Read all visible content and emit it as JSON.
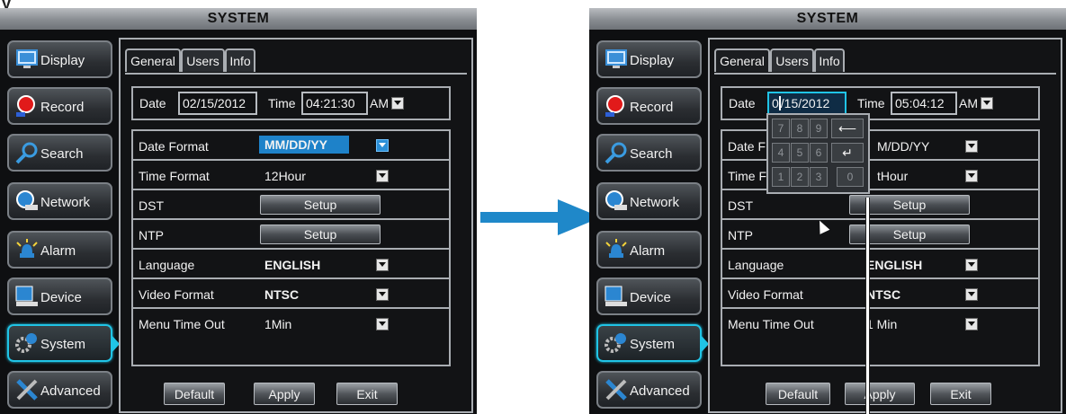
{
  "partial_heading": "y",
  "colors": {
    "accent": "#20c4e6",
    "arrow": "#1f88c9",
    "panel_bg": "#0e0f11",
    "highlight": "#1e82c9"
  },
  "left_panel": {
    "title": "SYSTEM",
    "sidebar": [
      {
        "label": "Display",
        "icon": "monitor-icon"
      },
      {
        "label": "Record",
        "icon": "record-icon"
      },
      {
        "label": "Search",
        "icon": "magnifier-icon"
      },
      {
        "label": "Network",
        "icon": "network-icon"
      },
      {
        "label": "Alarm",
        "icon": "alarm-icon"
      },
      {
        "label": "Device",
        "icon": "device-icon"
      },
      {
        "label": "System",
        "icon": "system-gear-icon",
        "active": true
      },
      {
        "label": "Advanced",
        "icon": "tools-icon"
      }
    ],
    "tabs": [
      "General",
      "Users",
      "Info"
    ],
    "date_label": "Date",
    "date_value": "02/15/2012",
    "time_label": "Time",
    "time_value": "04:21:30",
    "ampm": "AM",
    "rows": [
      {
        "label": "Date Format",
        "value": "MM/DD/YY",
        "control": "dropdown"
      },
      {
        "label": "Time Format",
        "value": "12Hour",
        "control": "dropdown"
      },
      {
        "label": "DST",
        "value": "Setup",
        "control": "button"
      },
      {
        "label": "NTP",
        "value": "Setup",
        "control": "button"
      },
      {
        "label": "Language",
        "value": "ENGLISH",
        "control": "dropdown"
      },
      {
        "label": "Video Format",
        "value": "NTSC",
        "control": "dropdown"
      },
      {
        "label": "Menu Time Out",
        "value": "1Min",
        "control": "dropdown"
      }
    ],
    "buttons": [
      "Default",
      "Apply",
      "Exit"
    ]
  },
  "right_panel": {
    "title": "SYSTEM",
    "sidebar": [
      {
        "label": "Display",
        "icon": "monitor-icon"
      },
      {
        "label": "Record",
        "icon": "record-icon"
      },
      {
        "label": "Search",
        "icon": "magnifier-icon"
      },
      {
        "label": "Network",
        "icon": "network-icon"
      },
      {
        "label": "Alarm",
        "icon": "alarm-icon"
      },
      {
        "label": "Device",
        "icon": "device-icon"
      },
      {
        "label": "System",
        "icon": "system-gear-icon",
        "active": true
      },
      {
        "label": "Advanced",
        "icon": "tools-icon"
      }
    ],
    "tabs": [
      "General",
      "Users",
      "Info"
    ],
    "date_label": "Date",
    "date_value_cursor": "0",
    "date_value_rest": "/15/2012",
    "time_label": "Time",
    "time_value": "05:04:12",
    "ampm": "AM",
    "rows": [
      {
        "label": "Date F",
        "value": "M/DD/YY"
      },
      {
        "label": "Time F",
        "value": "tHour"
      },
      {
        "label": "DST",
        "value": "Setup"
      },
      {
        "label": "NTP",
        "value": "Setup"
      },
      {
        "label": "Language",
        "value": "ENGLISH"
      },
      {
        "label": "Video Format",
        "value": "NTSC"
      },
      {
        "label": "Menu Time Out",
        "value": "1 Min"
      }
    ],
    "keypad": {
      "row1": [
        "7",
        "8",
        "9"
      ],
      "row2": [
        "4",
        "5",
        "6"
      ],
      "row3": [
        "1",
        "2",
        "3",
        "0"
      ],
      "backspace": "⟵",
      "enter": "↵"
    },
    "buttons": [
      "Default",
      "Apply",
      "Exit"
    ]
  }
}
